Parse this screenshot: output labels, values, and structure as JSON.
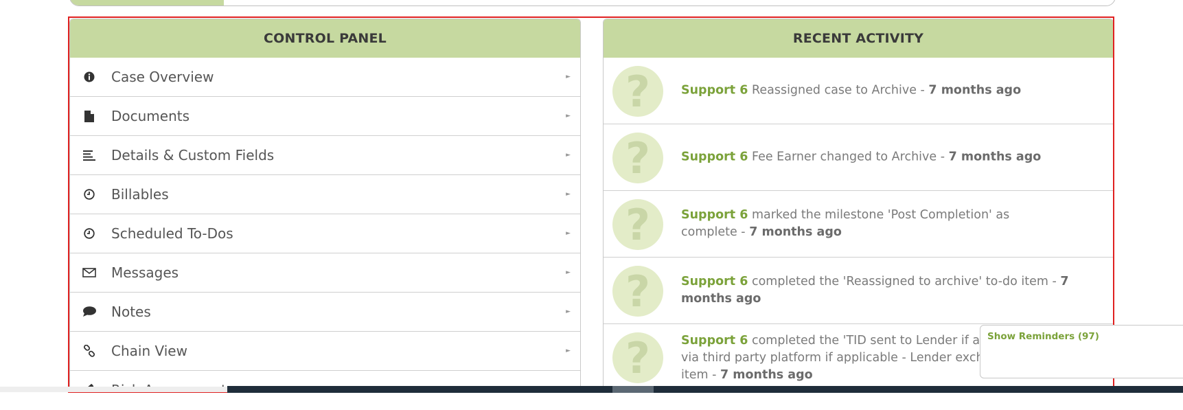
{
  "control_panel": {
    "title": "CONTROL PANEL",
    "items": [
      {
        "label": "Case Overview",
        "icon": "info-circle-icon"
      },
      {
        "label": "Documents",
        "icon": "document-icon"
      },
      {
        "label": "Details & Custom Fields",
        "icon": "align-left-icon"
      },
      {
        "label": "Billables",
        "icon": "clock-icon"
      },
      {
        "label": "Scheduled To-Dos",
        "icon": "clock-icon"
      },
      {
        "label": "Messages",
        "icon": "envelope-icon"
      },
      {
        "label": "Notes",
        "icon": "comment-icon"
      },
      {
        "label": "Chain View",
        "icon": "link-icon"
      },
      {
        "label": "Risk Assessment",
        "icon": "gavel-icon"
      }
    ],
    "arrow_glyph": "►"
  },
  "recent_activity": {
    "title": "RECENT ACTIVITY",
    "avatar_glyph": "?",
    "items": [
      {
        "user": "Support 6",
        "action": " Reassigned case to Archive - ",
        "time": "7 months ago"
      },
      {
        "user": "Support 6",
        "action": " Fee Earner changed to Archive - ",
        "time": "7 months ago"
      },
      {
        "user": "Support 6",
        "action": " marked the milestone 'Post Completion' as complete - ",
        "time": "7 months ago"
      },
      {
        "user": "Support 6",
        "action": " completed the 'Reassigned to archive' to-do item - ",
        "time": "7 months ago"
      },
      {
        "user": "Support 6",
        "action": " completed the 'TID sent to Lender if applicable' to-do item via third party platform if applicable - Lender exchange/LMS)' to-do item - ",
        "time": "7 months ago"
      }
    ]
  },
  "reminders": {
    "label": "Show Reminders (97)"
  },
  "colors": {
    "header_bg": "#c6d9a0",
    "accent_green": "#7ba23a",
    "highlight_border": "#e02020"
  }
}
